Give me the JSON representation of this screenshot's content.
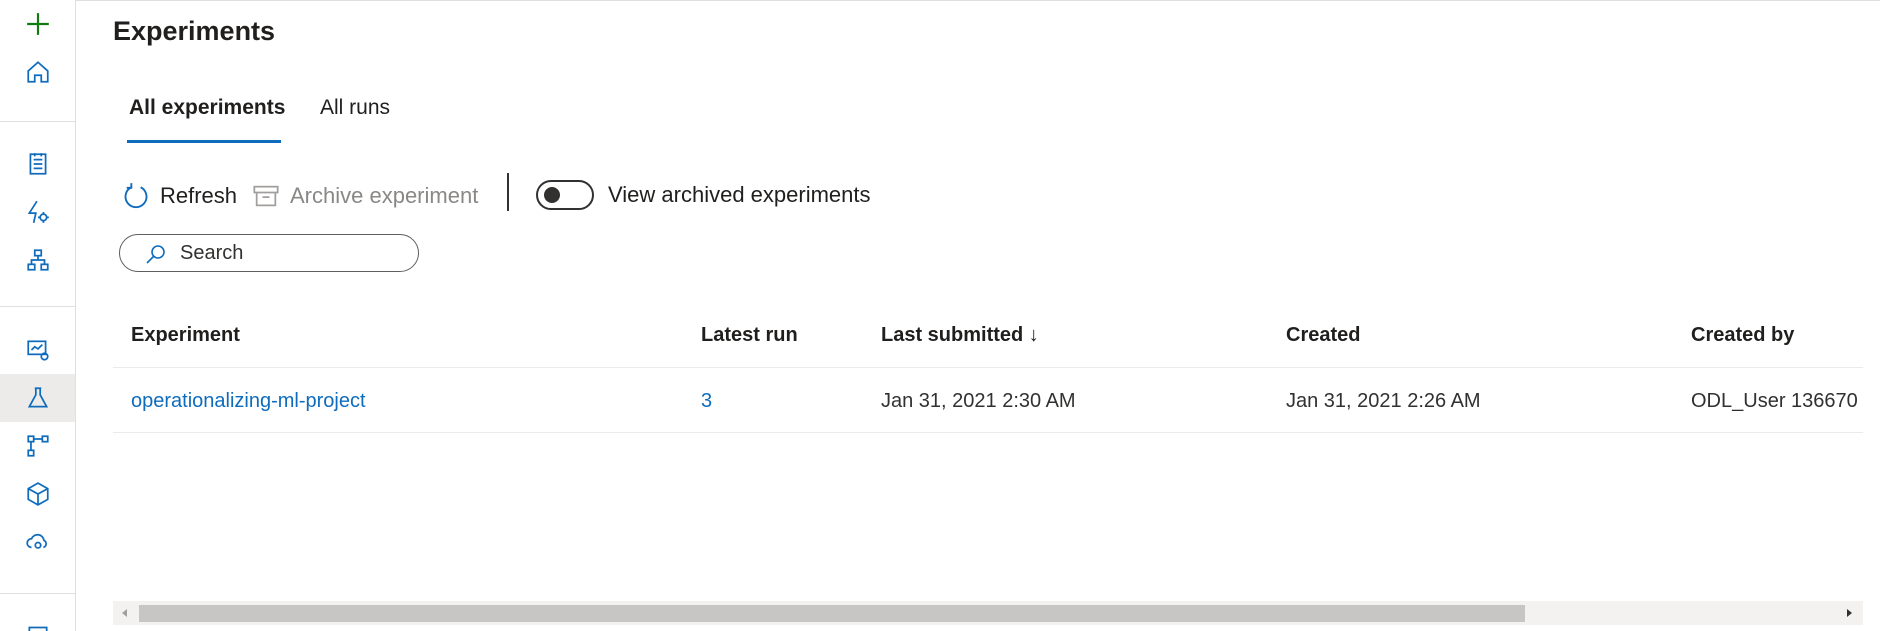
{
  "page": {
    "title": "Experiments"
  },
  "rail": {
    "items": [
      {
        "icon": "plus-icon"
      },
      {
        "icon": "home-icon"
      },
      {
        "icon": "notebook-icon"
      },
      {
        "icon": "automl-icon"
      },
      {
        "icon": "designer-icon"
      },
      {
        "icon": "datasets-icon"
      },
      {
        "icon": "experiments-icon",
        "active": true
      },
      {
        "icon": "pipelines-icon"
      },
      {
        "icon": "models-icon"
      },
      {
        "icon": "endpoints-icon"
      }
    ]
  },
  "tabs": [
    {
      "label": "All experiments",
      "active": true
    },
    {
      "label": "All runs",
      "active": false
    }
  ],
  "toolbar": {
    "refresh_label": "Refresh",
    "archive_label": "Archive experiment",
    "toggle_label": "View archived experiments",
    "toggle_on": false
  },
  "search": {
    "placeholder": "Search"
  },
  "table": {
    "columns": [
      "Experiment",
      "Latest run",
      "Last submitted ↓",
      "Created",
      "Created by"
    ],
    "rows": [
      {
        "experiment": "operationalizing-ml-project",
        "latest_run": "3",
        "last_submitted": "Jan 31, 2021 2:30 AM",
        "created": "Jan 31, 2021 2:26 AM",
        "created_by": "ODL_User 136670"
      }
    ]
  },
  "colors": {
    "accent": "#0f6cbd",
    "text": "#201f1e",
    "disabled": "#8a8886",
    "plus": "#107c10"
  }
}
